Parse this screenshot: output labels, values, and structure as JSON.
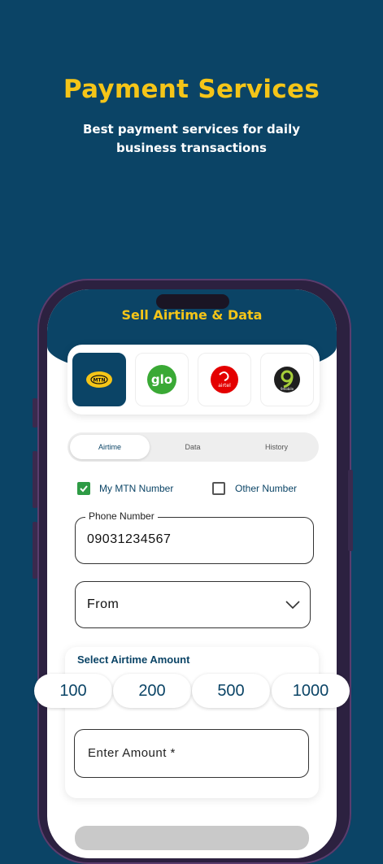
{
  "hero": {
    "title": "Payment Services",
    "subtitle": "Best payment services for daily business transactions"
  },
  "screen": {
    "title": "Sell Airtime & Data",
    "networks": [
      {
        "name": "mtn-logo",
        "label": "MTN",
        "color": "#f5c518",
        "active": true
      },
      {
        "name": "glo-logo",
        "label": "glo",
        "color": "#3aa935"
      },
      {
        "name": "airtel-logo",
        "label": "airtel",
        "color": "#e40000"
      },
      {
        "name": "9mobile-logo",
        "label": "9mobile",
        "color": "#1f1f1f"
      }
    ],
    "tabs": [
      "Airtime",
      "Data",
      "History"
    ],
    "options": {
      "my_number": "My MTN Number",
      "other_number": "Other Number"
    },
    "phone_field": {
      "label": "Phone Number",
      "value": "09031234567"
    },
    "from_select": {
      "value": "From"
    },
    "amount": {
      "title": "Select Airtime Amount",
      "chips": [
        "100",
        "200",
        "500",
        "1000"
      ],
      "input_placeholder": "Enter Amount *"
    }
  },
  "colors": {
    "background": "#0b4466",
    "accent": "#f5c518",
    "check": "#2e9b45"
  }
}
